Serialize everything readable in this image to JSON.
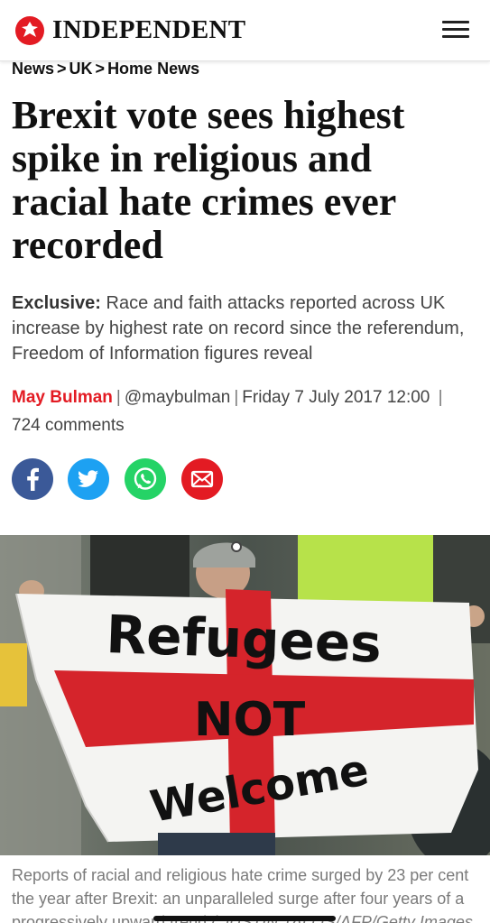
{
  "site": {
    "name": "INDEPENDENT",
    "brand_color": "#e31b23"
  },
  "breadcrumb": [
    "News",
    "UK",
    "Home News"
  ],
  "breadcrumb_sep": ">",
  "headline": "Brexit vote sees highest spike in religious and racial hate crimes ever recorded",
  "standfirst": {
    "label": "Exclusive:",
    "text": "Race and faith attacks reported across UK increase by highest rate on record since the referendum, Freedom of Information figures reveal"
  },
  "byline": {
    "author": "May Bulman",
    "handle": "@maybulman",
    "date": "Friday 7 July 2017 12:00",
    "comments": "724 comments"
  },
  "share": [
    {
      "name": "facebook-icon",
      "color": "#3b5998"
    },
    {
      "name": "twitter-icon",
      "color": "#1da1f2"
    },
    {
      "name": "whatsapp-icon",
      "color": "#25d366"
    },
    {
      "name": "email-icon",
      "color": "#e31b23"
    }
  ],
  "photo": {
    "flag_line1": "Refugees",
    "flag_line2": "NOT",
    "flag_line3": "Welcome"
  },
  "caption": {
    "text": "Reports of racial and religious hate crime surged by 23 per cent the year after Brexit: an unparalleled surge after four years of a progressively upward trend",
    "credit": "( JUSTIN TALLIS/AFP/Getty Images )"
  }
}
